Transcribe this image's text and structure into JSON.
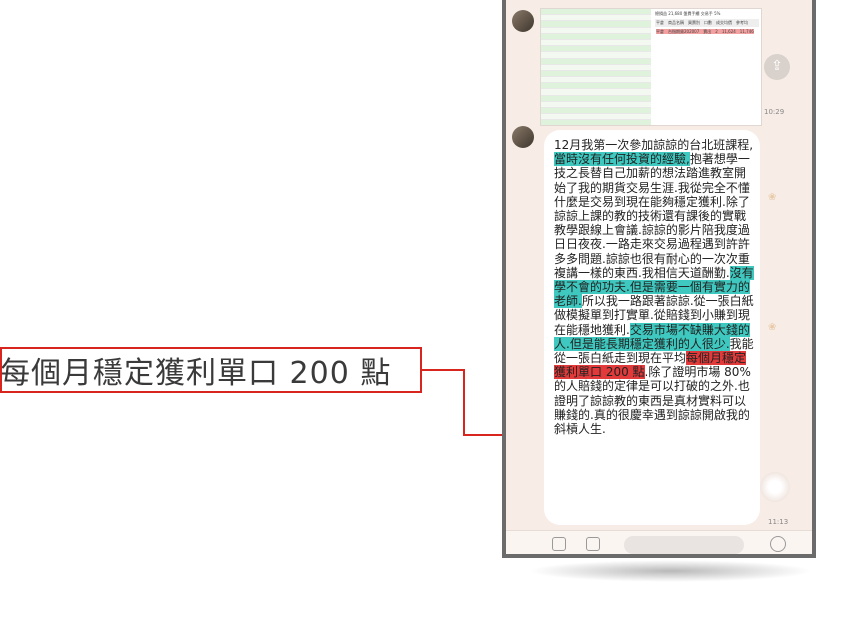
{
  "callout": {
    "text": "每個月穩定獲利單口 200 點"
  },
  "chat": {
    "image_message": {
      "sheet_title": "總損益 21,680 盤費手續 交易手 5%",
      "sheet_header": "平倉　商品名稱　買賣別　口數　成交均價　參考均",
      "sheet_row": "平倉　台指期貨202007　賣出　2　11,624　11,746"
    },
    "image_time": "10:29",
    "share_icon": "share-icon",
    "text_message": {
      "p1": "12月我第一次參加諒諒的台北班課程,",
      "h1": "當時沒有任何投資的經驗,",
      "p2": "抱著想學一技之長替自己加薪的想法踏進教室開始了我的期貨交易生涯.我從完全不懂什麼是交易到現在能夠穩定獲利.除了諒諒上課的教的技術還有課後的實戰教學跟線上會議.諒諒的影片陪我度過日日夜夜.一路走來交易過程遇到許許多多問題.諒諒也很有耐心的一次次重複講一樣的東西.我相信天道酬勤.",
      "h2": "沒有學不會的功夫.但是需要一個有實力的老師.",
      "p3": "所以我一路跟著諒諒.從一張白紙做模擬單到打實單.從賠錢到小賺到現在能穩地獲利.",
      "h3": "交易市場不缺賺大錢的人.但是能長期穩定獲利的人很少.",
      "p4": "我能從一張白紙走到現在平均",
      "h4": "每個月穩定獲利單口 200 點",
      "p5": ".除了證明市場 80% 的人賠錢的定律是可以打破的之外.也證明了諒諒教的東西是真材實料可以賺錢的.真的很慶幸遇到諒諒開啟我的斜槓人生."
    },
    "text_time": "11:13"
  },
  "colors": {
    "highlight_teal": "#3ec8bf",
    "highlight_red": "#e23a3a",
    "callout_border": "#d8261f",
    "chat_background": "#f7ece6"
  }
}
